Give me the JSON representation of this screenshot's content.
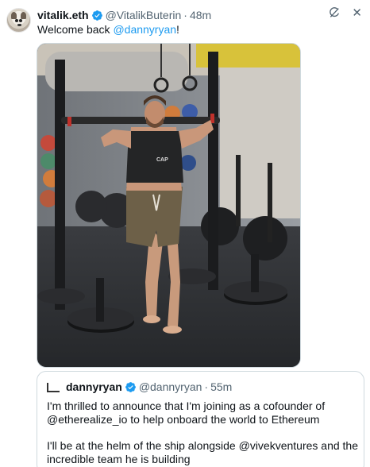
{
  "tweet": {
    "author_name": "vitalik.eth",
    "author_handle": "@VitalikButerin",
    "separator": "·",
    "time": "48m",
    "text_prefix": "Welcome back ",
    "text_mention": "@dannyryan",
    "text_suffix": "!"
  },
  "quote": {
    "author_name": "dannyryan",
    "author_handle": "@dannyryan",
    "separator": "·",
    "time": "55m",
    "paragraph1": "I'm thrilled to announce that I'm joining as a cofounder of @etherealize_io to help onboard the world to Ethereum",
    "paragraph2": "I'll be at the helm of the ship alongside @vivekventures and the incredible team he is building"
  },
  "photo": {
    "vest_text": "CAP"
  },
  "colors": {
    "accent": "#1d9bf0",
    "secondary_text": "#536471"
  },
  "icons": {
    "verified": "verified-badge-icon",
    "grok": "grok-icon",
    "close": "close-icon"
  }
}
